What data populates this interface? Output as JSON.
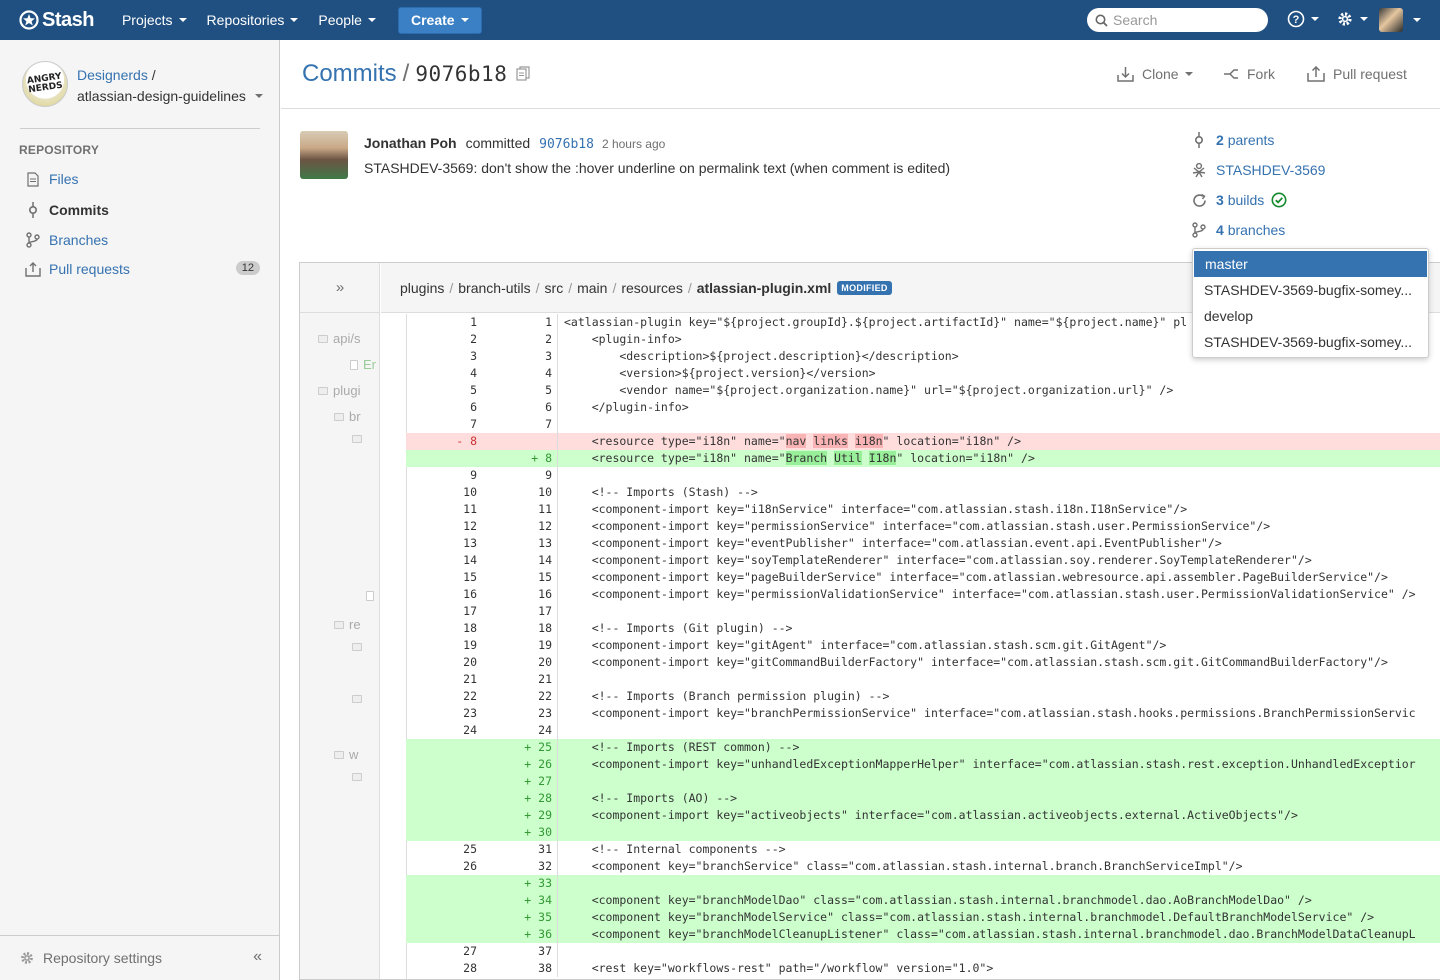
{
  "header": {
    "brand": "Stash",
    "nav": [
      {
        "label": "Projects"
      },
      {
        "label": "Repositories"
      },
      {
        "label": "People"
      }
    ],
    "create_label": "Create",
    "search_placeholder": "Search",
    "help_icon": "help-icon",
    "settings_icon": "gear-icon",
    "brand_color": "#205081"
  },
  "sidebar": {
    "project_name": "Designerds",
    "project_avatar_text": "ANGRY NERDS",
    "repo_name": "atlassian-design-guidelines",
    "section_heading": "REPOSITORY",
    "items": [
      {
        "label": "Files",
        "icon": "file-icon"
      },
      {
        "label": "Commits",
        "icon": "commit-icon"
      },
      {
        "label": "Branches",
        "icon": "branch-icon"
      },
      {
        "label": "Pull requests",
        "icon": "pull-request-icon",
        "badge": "12"
      }
    ],
    "footer_label": "Repository settings",
    "collapse_glyph": "«"
  },
  "page": {
    "crumb": "Commits",
    "separator": "/",
    "commit_hash": "9076b18",
    "actions": {
      "clone": "Clone",
      "fork": "Fork",
      "pull_request": "Pull request"
    }
  },
  "commit": {
    "author": "Jonathan Poh",
    "verb": "committed",
    "hash": "9076b18",
    "time": "2 hours ago",
    "message": "STASHDEV-3569: don't show the :hover underline on permalink text (when comment is edited)",
    "parents_count": "2",
    "parents_label": "parents",
    "issue": "STASHDEV-3569",
    "builds_count": "3",
    "builds_label": "builds",
    "branches_count": "4",
    "branches_label": "branches",
    "branches_dropdown": [
      "master",
      "STASHDEV-3569-bugfix-somey...",
      "develop",
      "STASHDEV-3569-bugfix-somey..."
    ],
    "status_color": "#14892c"
  },
  "diff": {
    "path": [
      "plugins",
      "branch-utils",
      "src",
      "main",
      "resources"
    ],
    "file": "atlassian-plugin.xml",
    "status": "MODIFIED",
    "tree_toggle": "»",
    "tree_nodes": [
      "api/s",
      "Er",
      "plugi",
      "br",
      "re",
      "w"
    ],
    "lines": [
      {
        "t": "ctx",
        "o": "1",
        "n": "1",
        "s": "<atlassian-plugin key=\"${project.groupId}.${project.artifactId}\" name=\"${project.name}\" pl"
      },
      {
        "t": "ctx",
        "o": "2",
        "n": "2",
        "s": "    <plugin-info>"
      },
      {
        "t": "ctx",
        "o": "3",
        "n": "3",
        "s": "        <description>${project.description}</description>"
      },
      {
        "t": "ctx",
        "o": "4",
        "n": "4",
        "s": "        <version>${project.version}</version>"
      },
      {
        "t": "ctx",
        "o": "5",
        "n": "5",
        "s": "        <vendor name=\"${project.organization.name}\" url=\"${project.organization.url}\" />"
      },
      {
        "t": "ctx",
        "o": "6",
        "n": "6",
        "s": "    </plugin-info>"
      },
      {
        "t": "ctx",
        "o": "7",
        "n": "7",
        "s": ""
      },
      {
        "t": "del",
        "o": "- 8",
        "n": "",
        "s": "    <resource type=\"i18n\" name=\"nav links i18n\" location=\"i18n\" />"
      },
      {
        "t": "add",
        "o": "",
        "n": "+ 8",
        "s": "    <resource type=\"i18n\" name=\"Branch Util I18n\" location=\"i18n\" />"
      },
      {
        "t": "ctx",
        "o": "9",
        "n": "9",
        "s": ""
      },
      {
        "t": "ctx",
        "o": "10",
        "n": "10",
        "s": "    <!-- Imports (Stash) -->"
      },
      {
        "t": "ctx",
        "o": "11",
        "n": "11",
        "s": "    <component-import key=\"i18nService\" interface=\"com.atlassian.stash.i18n.I18nService\"/>"
      },
      {
        "t": "ctx",
        "o": "12",
        "n": "12",
        "s": "    <component-import key=\"permissionService\" interface=\"com.atlassian.stash.user.PermissionService\"/>"
      },
      {
        "t": "ctx",
        "o": "13",
        "n": "13",
        "s": "    <component-import key=\"eventPublisher\" interface=\"com.atlassian.event.api.EventPublisher\"/>"
      },
      {
        "t": "ctx",
        "o": "14",
        "n": "14",
        "s": "    <component-import key=\"soyTemplateRenderer\" interface=\"com.atlassian.soy.renderer.SoyTemplateRenderer\"/>"
      },
      {
        "t": "ctx",
        "o": "15",
        "n": "15",
        "s": "    <component-import key=\"pageBuilderService\" interface=\"com.atlassian.webresource.api.assembler.PageBuilderService\"/>"
      },
      {
        "t": "ctx",
        "o": "16",
        "n": "16",
        "s": "    <component-import key=\"permissionValidationService\" interface=\"com.atlassian.stash.user.PermissionValidationService\" />"
      },
      {
        "t": "ctx",
        "o": "17",
        "n": "17",
        "s": ""
      },
      {
        "t": "ctx",
        "o": "18",
        "n": "18",
        "s": "    <!-- Imports (Git plugin) -->"
      },
      {
        "t": "ctx",
        "o": "19",
        "n": "19",
        "s": "    <component-import key=\"gitAgent\" interface=\"com.atlassian.stash.scm.git.GitAgent\"/>"
      },
      {
        "t": "ctx",
        "o": "20",
        "n": "20",
        "s": "    <component-import key=\"gitCommandBuilderFactory\" interface=\"com.atlassian.stash.scm.git.GitCommandBuilderFactory\"/>"
      },
      {
        "t": "ctx",
        "o": "21",
        "n": "21",
        "s": ""
      },
      {
        "t": "ctx",
        "o": "22",
        "n": "22",
        "s": "    <!-- Imports (Branch permission plugin) -->"
      },
      {
        "t": "ctx",
        "o": "23",
        "n": "23",
        "s": "    <component-import key=\"branchPermissionService\" interface=\"com.atlassian.stash.hooks.permissions.BranchPermissionServic"
      },
      {
        "t": "ctx",
        "o": "24",
        "n": "24",
        "s": ""
      },
      {
        "t": "add",
        "o": "",
        "n": "+ 25",
        "s": "    <!-- Imports (REST common) -->"
      },
      {
        "t": "add",
        "o": "",
        "n": "+ 26",
        "s": "    <component-import key=\"unhandledExceptionMapperHelper\" interface=\"com.atlassian.stash.rest.exception.UnhandledExceptior"
      },
      {
        "t": "add",
        "o": "",
        "n": "+ 27",
        "s": ""
      },
      {
        "t": "add",
        "o": "",
        "n": "+ 28",
        "s": "    <!-- Imports (AO) -->"
      },
      {
        "t": "add",
        "o": "",
        "n": "+ 29",
        "s": "    <component-import key=\"activeobjects\" interface=\"com.atlassian.activeobjects.external.ActiveObjects\"/>"
      },
      {
        "t": "add",
        "o": "",
        "n": "+ 30",
        "s": ""
      },
      {
        "t": "ctx",
        "o": "25",
        "n": "31",
        "s": "    <!-- Internal components -->"
      },
      {
        "t": "ctx",
        "o": "26",
        "n": "32",
        "s": "    <component key=\"branchService\" class=\"com.atlassian.stash.internal.branch.BranchServiceImpl\"/>"
      },
      {
        "t": "add",
        "o": "",
        "n": "+ 33",
        "s": ""
      },
      {
        "t": "add",
        "o": "",
        "n": "+ 34",
        "s": "    <component key=\"branchModelDao\" class=\"com.atlassian.stash.internal.branchmodel.dao.AoBranchModelDao\" />"
      },
      {
        "t": "add",
        "o": "",
        "n": "+ 35",
        "s": "    <component key=\"branchModelService\" class=\"com.atlassian.stash.internal.branchmodel.DefaultBranchModelService\" />"
      },
      {
        "t": "add",
        "o": "",
        "n": "+ 36",
        "s": "    <component key=\"branchModelCleanupListener\" class=\"com.atlassian.stash.internal.branchmodel.dao.BranchModelDataCleanupL"
      },
      {
        "t": "ctx",
        "o": "27",
        "n": "37",
        "s": ""
      },
      {
        "t": "ctx",
        "o": "28",
        "n": "38",
        "s": "    <rest key=\"workflows-rest\" path=\"/workflow\" version=\"1.0\">"
      }
    ],
    "highlights": {
      "del_words": [
        "nav",
        "links",
        "i18n"
      ],
      "add_words": [
        "Branch",
        "Util",
        "I18n"
      ]
    }
  }
}
